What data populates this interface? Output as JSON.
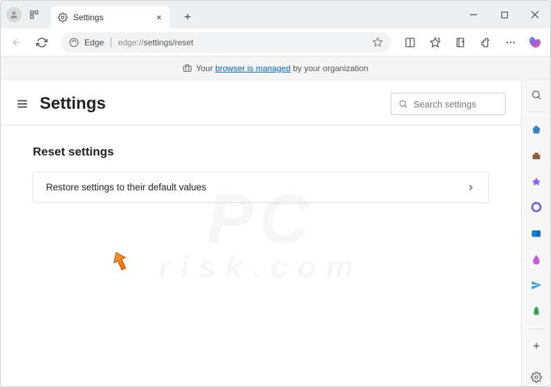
{
  "tab": {
    "title": "Settings"
  },
  "address": {
    "app": "Edge",
    "url_prefix": "edge://",
    "url_path": "settings/reset"
  },
  "managed_banner": {
    "prefix": "Your ",
    "link": "browser is managed",
    "suffix": " by your organization"
  },
  "settings": {
    "title": "Settings",
    "search_placeholder": "Search settings"
  },
  "reset": {
    "section_title": "Reset settings",
    "item_label": "Restore settings to their default values"
  },
  "watermark": {
    "main": "PC",
    "sub": "risk.com"
  }
}
